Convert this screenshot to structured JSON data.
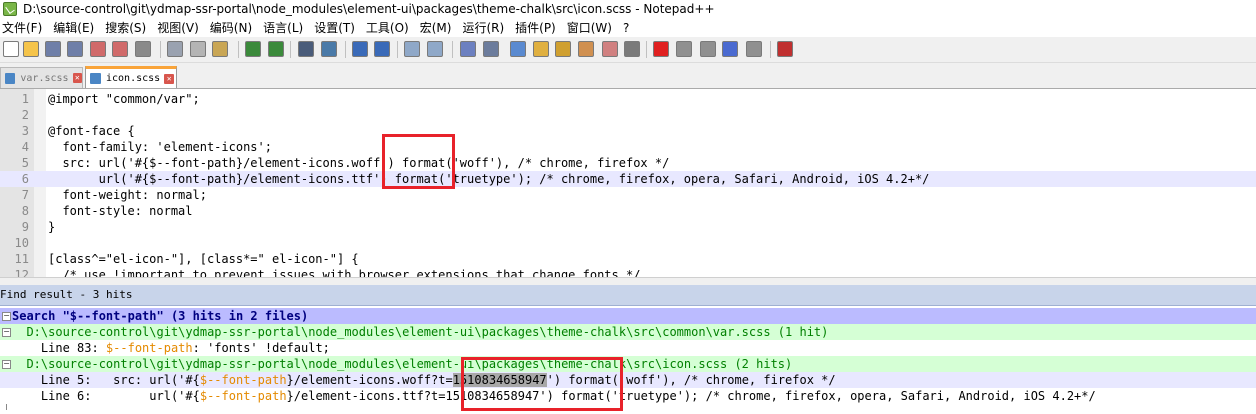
{
  "window": {
    "title": "D:\\source-control\\git\\ydmap-ssr-portal\\node_modules\\element-ui\\packages\\theme-chalk\\src\\icon.scss - Notepad++"
  },
  "menu": [
    "文件(F)",
    "编辑(E)",
    "搜索(S)",
    "视图(V)",
    "编码(N)",
    "语言(L)",
    "设置(T)",
    "工具(O)",
    "宏(M)",
    "运行(R)",
    "插件(P)",
    "窗口(W)",
    "?"
  ],
  "tabs": [
    {
      "label": "var.scss",
      "active": false
    },
    {
      "label": "icon.scss",
      "active": true
    }
  ],
  "editor": {
    "lines": [
      {
        "n": "1",
        "text": "@import \"common/var\";"
      },
      {
        "n": "2",
        "text": ""
      },
      {
        "n": "3",
        "text": "@font-face {"
      },
      {
        "n": "4",
        "text": "  font-family: 'element-icons';"
      },
      {
        "n": "5",
        "text": "  src: url('#{$--font-path}/element-icons.woff') format('woff'), /* chrome, firefox */"
      },
      {
        "n": "6",
        "text": "       url('#{$--font-path}/element-icons.ttf') format('truetype'); /* chrome, firefox, opera, Safari, Android, iOS 4.2+*/"
      },
      {
        "n": "7",
        "text": "  font-weight: normal;"
      },
      {
        "n": "8",
        "text": "  font-style: normal"
      },
      {
        "n": "9",
        "text": "}"
      },
      {
        "n": "10",
        "text": ""
      },
      {
        "n": "11",
        "text": "[class^=\"el-icon-\"], [class*=\" el-icon-\"] {"
      },
      {
        "n": "12",
        "text": "  /* use !important to prevent issues with browser extensions that change fonts */"
      }
    ],
    "current_line": "6"
  },
  "find": {
    "header": "Find result - 3 hits",
    "search_line": "Search \"$--font-path\" (3 hits in 2 files)",
    "file1": "  D:\\source-control\\git\\ydmap-ssr-portal\\node_modules\\element-ui\\packages\\theme-chalk\\src\\common\\var.scss (1 hit)",
    "hit1": {
      "prefix": "    Line 83: ",
      "kw": "$--font-path",
      "rest": ": 'fonts' !default;"
    },
    "file2": "  D:\\source-control\\git\\ydmap-ssr-portal\\node_modules\\element-ui\\packages\\theme-chalk\\src\\icon.scss (2 hits)",
    "hit2": {
      "prefix": "    Line 5:   src: url('#{",
      "kw": "$--font-path",
      "mid": "}/element-icons.woff?t=",
      "num": "1510834658947",
      "rest": "') format('woff'), /* chrome, firefox */"
    },
    "hit3": {
      "prefix": "    Line 6:        url('#{",
      "kw": "$--font-path",
      "mid": "}/element-icons.ttf?t=1510834658947",
      "rest": "') format('truetype'); /* chrome, firefox, opera, Safari, Android, iOS 4.2+*/"
    }
  },
  "toolbar_icons": [
    "new-file-icon",
    "open-file-icon",
    "save-icon",
    "save-all-icon",
    "close-icon",
    "close-all-icon",
    "print-icon",
    "cut-icon",
    "copy-icon",
    "paste-icon",
    "undo-icon",
    "redo-icon",
    "find-icon",
    "replace-icon",
    "zoom-in-icon",
    "zoom-out-icon",
    "sync-vertical-icon",
    "sync-horizontal-icon",
    "word-wrap-icon",
    "show-all-chars-icon",
    "indent-guide-icon",
    "user-lang-icon",
    "doc-map-icon",
    "function-list-icon",
    "folder-workspace-icon",
    "monitor-icon",
    "record-macro-icon",
    "stop-record-icon",
    "play-macro-icon",
    "run-macro-multiple-icon",
    "save-macro-icon",
    "spellcheck-icon"
  ],
  "colors": {
    "accent_tab": "#f9a43a",
    "highlight_box": "#e8222a",
    "search_row": "#bbbbff",
    "file_row": "#d5ffd5",
    "keyword": "#e48a00"
  }
}
